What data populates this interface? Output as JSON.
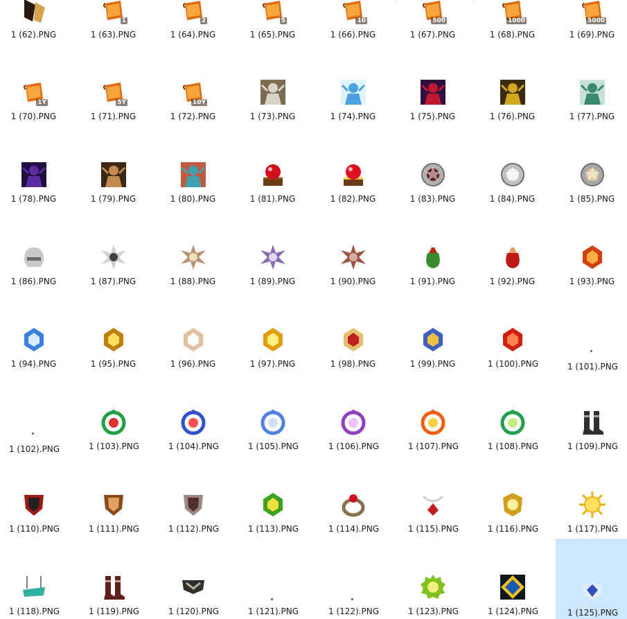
{
  "files": [
    {
      "name": "1 (62).PNG",
      "icon": "claw-icon",
      "colors": [
        "#2b1a10",
        "#d7a24a"
      ]
    },
    {
      "name": "1 (63).PNG",
      "icon": "scroll-icon",
      "badge": "1",
      "colors": [
        "#e06a10",
        "#ffc050"
      ]
    },
    {
      "name": "1 (64).PNG",
      "icon": "scroll-icon",
      "badge": "2",
      "colors": [
        "#e06a10",
        "#ffc050"
      ]
    },
    {
      "name": "1 (65).PNG",
      "icon": "scroll-icon",
      "badge": "5",
      "colors": [
        "#e06a10",
        "#ffc050"
      ]
    },
    {
      "name": "1 (66).PNG",
      "icon": "scroll-icon",
      "badge": "10",
      "colors": [
        "#e06a10",
        "#ffc050"
      ]
    },
    {
      "name": "1 (67).PNG",
      "icon": "scroll-icon",
      "badge": "500",
      "colors": [
        "#e06a10",
        "#ffc050"
      ]
    },
    {
      "name": "1 (68).PNG",
      "icon": "scroll-icon",
      "badge": "1000",
      "colors": [
        "#e06a10",
        "#ffc050"
      ]
    },
    {
      "name": "1 (69).PNG",
      "icon": "scroll-icon",
      "badge": "5000",
      "colors": [
        "#e06a10",
        "#ffc050"
      ]
    },
    {
      "name": "1 (70).PNG",
      "icon": "scroll-icon",
      "badge": "1Y",
      "colors": [
        "#e06a10",
        "#ffc050"
      ]
    },
    {
      "name": "1 (71).PNG",
      "icon": "scroll-icon",
      "badge": "5Y",
      "colors": [
        "#e06a10",
        "#ffc050"
      ]
    },
    {
      "name": "1 (72).PNG",
      "icon": "scroll-icon",
      "badge": "10Y",
      "colors": [
        "#e06a10",
        "#ffc050"
      ]
    },
    {
      "name": "1 (73).PNG",
      "icon": "armored-figure-icon",
      "colors": [
        "#d8d4c8",
        "#7a6a50"
      ]
    },
    {
      "name": "1 (74).PNG",
      "icon": "armored-figure-icon",
      "colors": [
        "#4aa0e0",
        "#dff4ff"
      ]
    },
    {
      "name": "1 (75).PNG",
      "icon": "armored-figure-icon",
      "colors": [
        "#c01830",
        "#301040"
      ]
    },
    {
      "name": "1 (76).PNG",
      "icon": "armored-figure-icon",
      "colors": [
        "#d0a820",
        "#3a2a10"
      ]
    },
    {
      "name": "1 (77).PNG",
      "icon": "armored-figure-icon",
      "colors": [
        "#3a8a70",
        "#c8e0d8"
      ]
    },
    {
      "name": "1 (78).PNG",
      "icon": "portrait-icon",
      "colors": [
        "#5a2aa0",
        "#201040"
      ]
    },
    {
      "name": "1 (79).PNG",
      "icon": "portrait-icon",
      "colors": [
        "#c08a50",
        "#402818"
      ]
    },
    {
      "name": "1 (80).PNG",
      "icon": "portrait-icon",
      "colors": [
        "#40a0b0",
        "#c05a40"
      ]
    },
    {
      "name": "1 (81).PNG",
      "icon": "orb-chest-icon",
      "colors": [
        "#d01020",
        "#8a5010"
      ]
    },
    {
      "name": "1 (82).PNG",
      "icon": "orb-chest-icon",
      "colors": [
        "#e01020",
        "#ffd040"
      ]
    },
    {
      "name": "1 (83).PNG",
      "icon": "medal-icon",
      "colors": [
        "#b0b0b0",
        "#601818"
      ]
    },
    {
      "name": "1 (84).PNG",
      "icon": "medal-icon",
      "colors": [
        "#c0c0c0",
        "#f0f0f0"
      ]
    },
    {
      "name": "1 (85).PNG",
      "icon": "medal-icon",
      "colors": [
        "#a8a8a8",
        "#e0c890"
      ]
    },
    {
      "name": "1 (86).PNG",
      "icon": "helmet-icon",
      "colors": [
        "#c8c8c8",
        "#6a6a6a"
      ]
    },
    {
      "name": "1 (87).PNG",
      "icon": "spiked-star-icon",
      "colors": [
        "#d0d0d0",
        "#404040"
      ]
    },
    {
      "name": "1 (88).PNG",
      "icon": "spiked-star-icon",
      "colors": [
        "#b89070",
        "#f0e0c0"
      ]
    },
    {
      "name": "1 (89).PNG",
      "icon": "spiked-star-icon",
      "colors": [
        "#8a6ab0",
        "#e0d8f0"
      ]
    },
    {
      "name": "1 (90).PNG",
      "icon": "spiked-star-icon",
      "colors": [
        "#a05040",
        "#d0b0a0"
      ]
    },
    {
      "name": "1 (91).PNG",
      "icon": "pouch-icon",
      "colors": [
        "#3a8a30",
        "#c02010"
      ]
    },
    {
      "name": "1 (92).PNG",
      "icon": "pouch-icon",
      "colors": [
        "#c01818",
        "#e0a060"
      ]
    },
    {
      "name": "1 (93).PNG",
      "icon": "emblem-icon",
      "colors": [
        "#d04010",
        "#ffb040"
      ]
    },
    {
      "name": "1 (94).PNG",
      "icon": "crystal-emblem-icon",
      "colors": [
        "#3a80e0",
        "#d8ecff"
      ]
    },
    {
      "name": "1 (95).PNG",
      "icon": "crystal-emblem-icon",
      "colors": [
        "#c08010",
        "#ffe060"
      ]
    },
    {
      "name": "1 (96).PNG",
      "icon": "crystal-emblem-icon",
      "colors": [
        "#e0c0a0",
        "#ffffff"
      ]
    },
    {
      "name": "1 (97).PNG",
      "icon": "crystal-emblem-icon",
      "colors": [
        "#e0a010",
        "#fff080"
      ]
    },
    {
      "name": "1 (98).PNG",
      "icon": "crystal-emblem-icon",
      "colors": [
        "#e0c070",
        "#c02020"
      ]
    },
    {
      "name": "1 (99).PNG",
      "icon": "crystal-emblem-icon",
      "colors": [
        "#4060c0",
        "#f0c040"
      ]
    },
    {
      "name": "1 (100).PNG",
      "icon": "crystal-emblem-icon",
      "colors": [
        "#d02010",
        "#ff8050"
      ]
    },
    {
      "name": "1 (101).PNG",
      "icon": "blank-icon",
      "colors": [
        "#555555",
        "#ffffff"
      ]
    },
    {
      "name": "1 (102).PNG",
      "icon": "blank-icon",
      "colors": [
        "#555555",
        "#ffffff"
      ]
    },
    {
      "name": "1 (103).PNG",
      "icon": "gem-ring-icon",
      "colors": [
        "#20a040",
        "#e03030"
      ]
    },
    {
      "name": "1 (104).PNG",
      "icon": "gem-ring-icon",
      "colors": [
        "#3050d0",
        "#ff5050"
      ]
    },
    {
      "name": "1 (105).PNG",
      "icon": "gem-ring-icon",
      "colors": [
        "#5080e0",
        "#d0e0ff"
      ]
    },
    {
      "name": "1 (106).PNG",
      "icon": "gem-ring-icon",
      "colors": [
        "#9040c0",
        "#f0c0ff"
      ]
    },
    {
      "name": "1 (107).PNG",
      "icon": "gem-ring-icon",
      "colors": [
        "#f06010",
        "#ffd040"
      ]
    },
    {
      "name": "1 (108).PNG",
      "icon": "gem-ring-icon",
      "colors": [
        "#20a050",
        "#c0f080"
      ]
    },
    {
      "name": "1 (109).PNG",
      "icon": "boots-icon",
      "colors": [
        "#303030",
        "#a0a0a0"
      ]
    },
    {
      "name": "1 (110).PNG",
      "icon": "shield-icon",
      "colors": [
        "#a01818",
        "#202020"
      ]
    },
    {
      "name": "1 (111).PNG",
      "icon": "shield-icon",
      "colors": [
        "#8a4a20",
        "#e0a060"
      ]
    },
    {
      "name": "1 (112).PNG",
      "icon": "shield-icon",
      "colors": [
        "#9a8a80",
        "#503030"
      ]
    },
    {
      "name": "1 (113).PNG",
      "icon": "crystal-emblem-icon",
      "colors": [
        "#40a020",
        "#f0e040"
      ]
    },
    {
      "name": "1 (114).PNG",
      "icon": "ring-icon",
      "colors": [
        "#8a7050",
        "#d01020"
      ]
    },
    {
      "name": "1 (115).PNG",
      "icon": "pendant-icon",
      "colors": [
        "#d0d0d0",
        "#c02020"
      ]
    },
    {
      "name": "1 (116).PNG",
      "icon": "lion-crest-icon",
      "colors": [
        "#d0a020",
        "#fff0a0"
      ]
    },
    {
      "name": "1 (117).PNG",
      "icon": "sun-icon",
      "colors": [
        "#f0b010",
        "#ffe060"
      ]
    },
    {
      "name": "1 (118).PNG",
      "icon": "cart-icon",
      "colors": [
        "#30b0a0",
        "#808080"
      ]
    },
    {
      "name": "1 (119).PNG",
      "icon": "boots-icon",
      "colors": [
        "#602018",
        "#c0a080"
      ]
    },
    {
      "name": "1 (120).PNG",
      "icon": "belt-icon",
      "colors": [
        "#303030",
        "#c0b0a0"
      ]
    },
    {
      "name": "1 (121).PNG",
      "icon": "blank-icon",
      "colors": [
        "#555555",
        "#ffffff"
      ]
    },
    {
      "name": "1 (122).PNG",
      "icon": "blank-icon",
      "colors": [
        "#555555",
        "#ffffff"
      ]
    },
    {
      "name": "1 (123).PNG",
      "icon": "gear-emblem-icon",
      "colors": [
        "#80c020",
        "#f0f080"
      ]
    },
    {
      "name": "1 (124).PNG",
      "icon": "diamond-emblem-icon",
      "colors": [
        "#1a5ab0",
        "#f0c020"
      ]
    },
    {
      "name": "1 (125).PNG",
      "icon": "winged-emblem-icon",
      "colors": [
        "#3050c0",
        "#e0ecff"
      ],
      "selected": true
    }
  ]
}
